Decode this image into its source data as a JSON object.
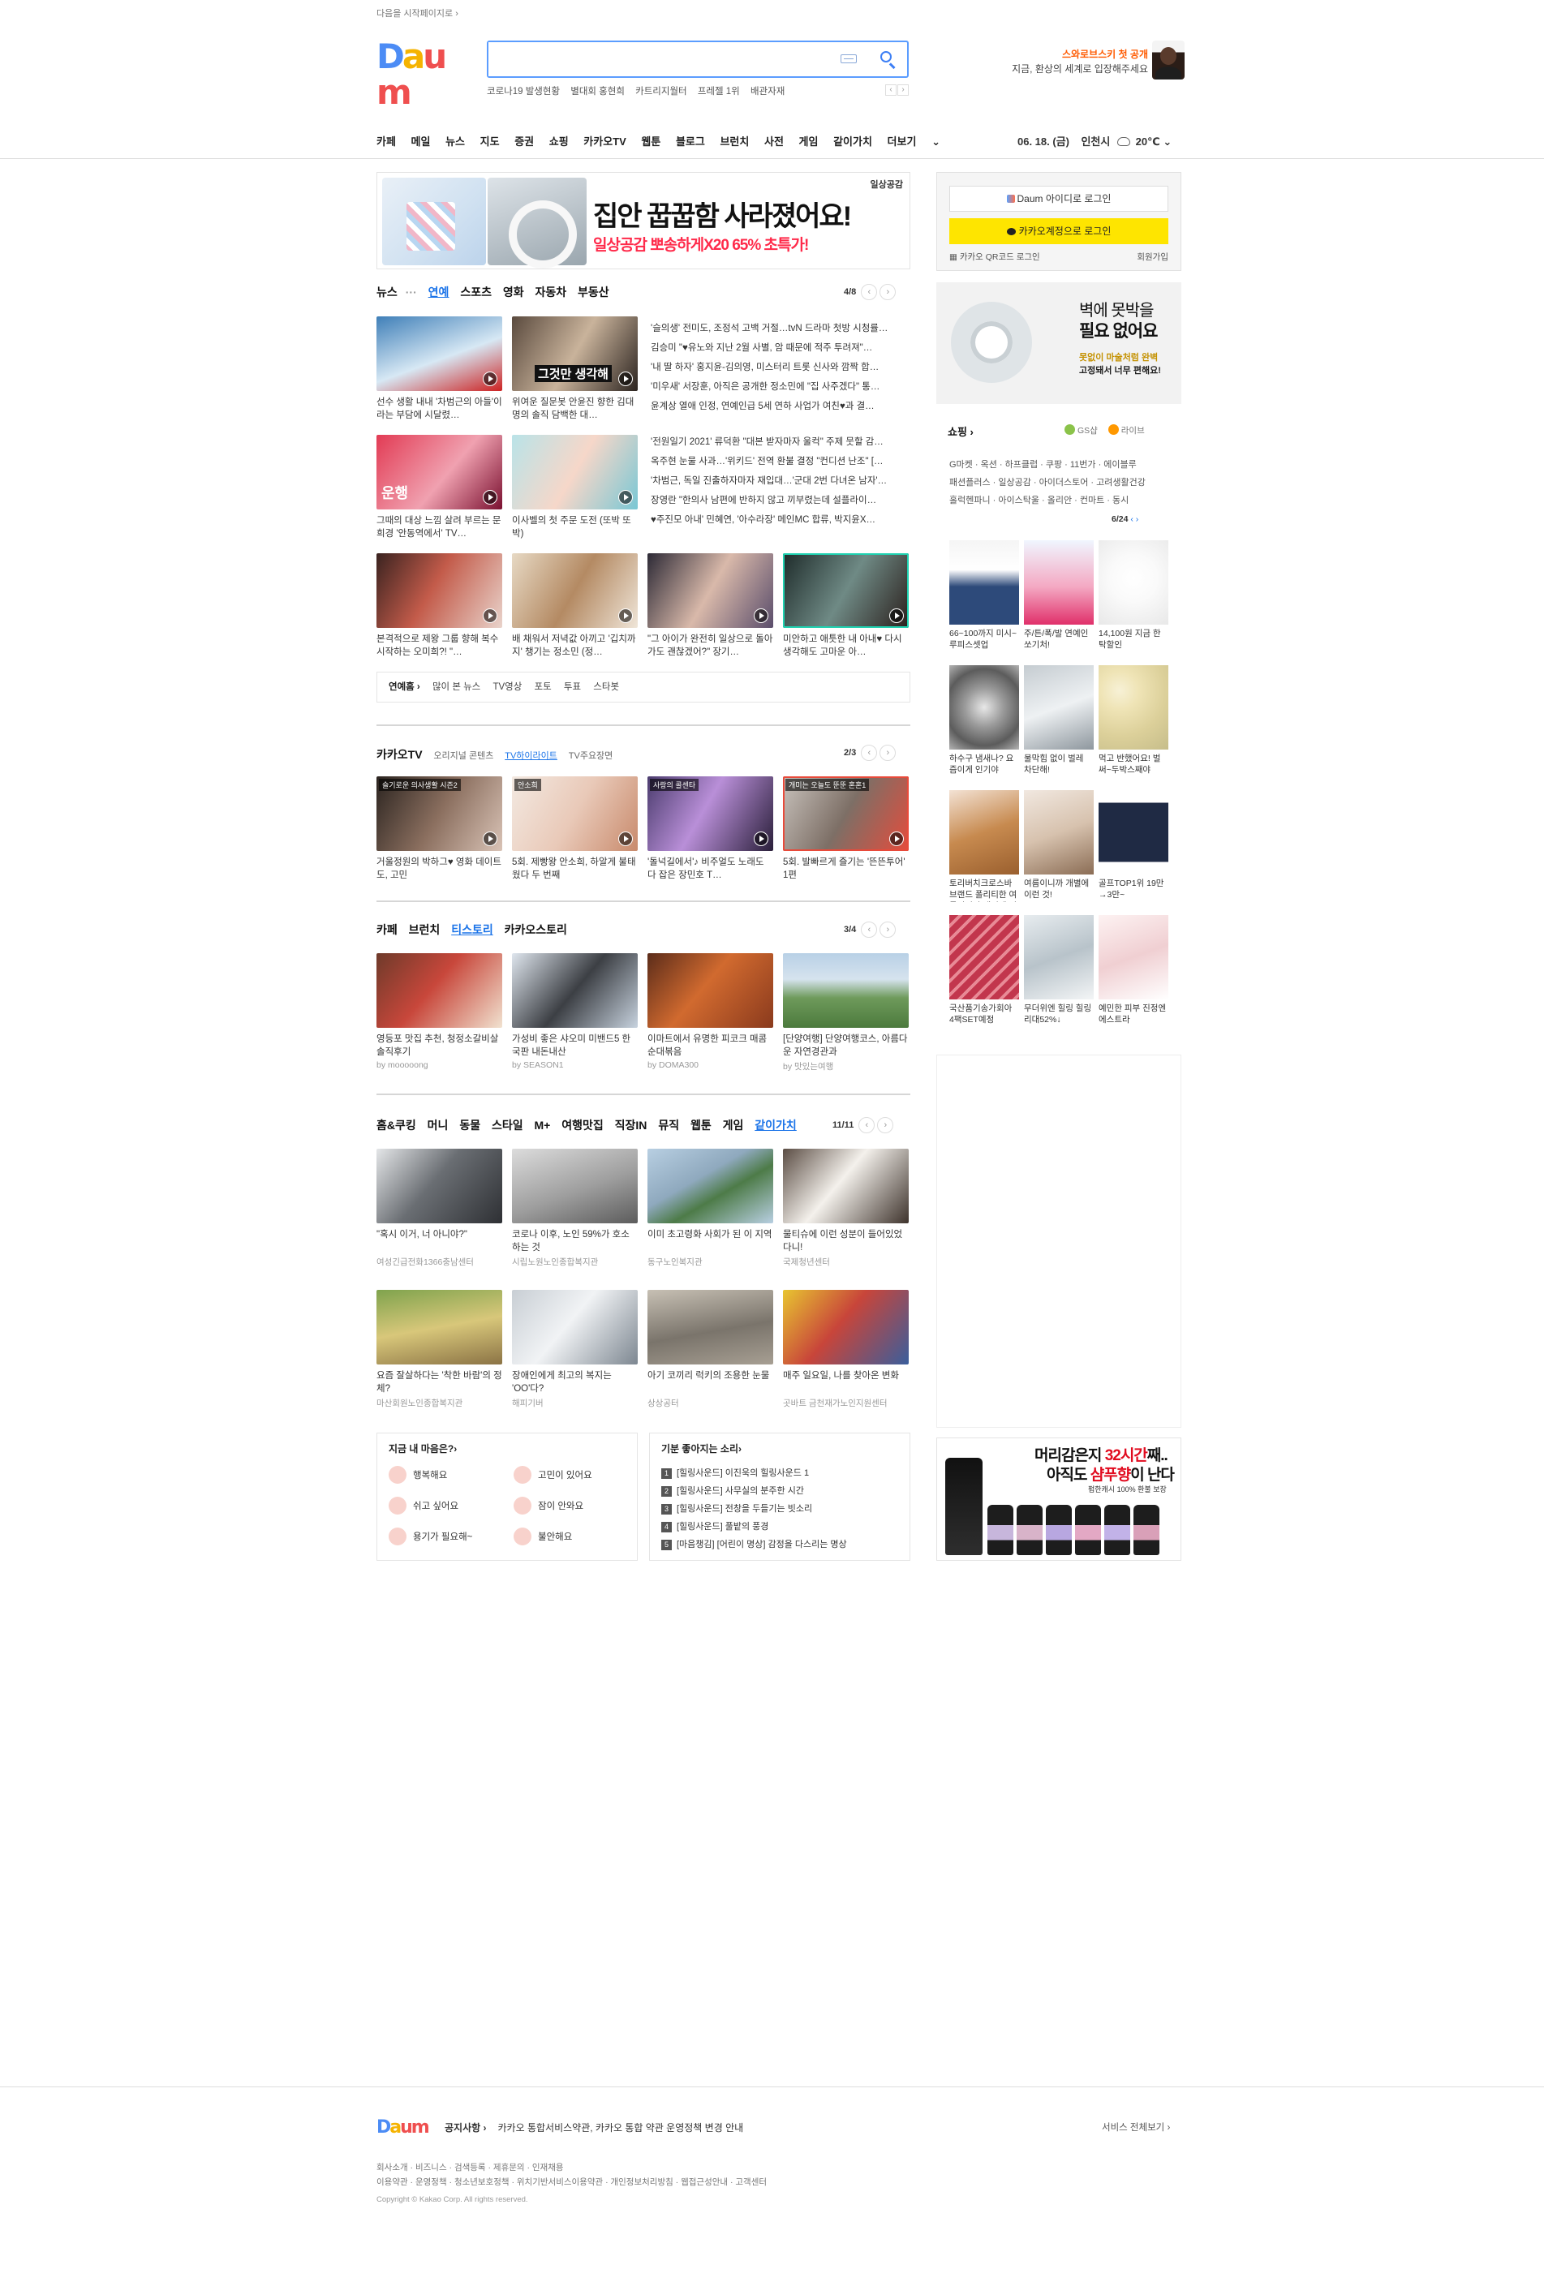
{
  "top": {
    "set_home": "다음을 시작페이지로 ›"
  },
  "logo": {
    "letters": [
      "D",
      "a",
      "u",
      "m"
    ]
  },
  "search": {
    "placeholder": "",
    "value": ""
  },
  "trending": [
    "코로나19 발생현황",
    "별대회 홍현희",
    "카트리지월터",
    "프레젤 1위",
    "배관자재"
  ],
  "promo": {
    "title": "스와로브스키 첫 공개",
    "subtitle": "지금, 환상의 세계로 입장해주세요"
  },
  "gnb": [
    "카페",
    "메일",
    "뉴스",
    "지도",
    "증권",
    "쇼핑",
    "카카오TV",
    "웹툰",
    "블로그",
    "브런치",
    "사전",
    "게임",
    "같이가치",
    "더보기"
  ],
  "weather": {
    "date": "06. 18. (금)",
    "city": "인천시",
    "temp": "20℃"
  },
  "ad_main": {
    "title": "집안 꿉꿉함 사라졌어요!",
    "sub": "일상공감 뽀송하게X20 65% 초특가!",
    "brand": "일상공감"
  },
  "login": {
    "daum_btn": "Daum 아이디로 로그인",
    "kakao_btn": "카카오계정으로 로그인",
    "qr": "카카오 QR코드 로그인",
    "join": "회원가입"
  },
  "ad_tape": {
    "l1": "벽에 못박을",
    "l2": "필요 없어요",
    "l3": "못없이 마술처럼 완벽",
    "l4": "고정돼서 너무 편해요!"
  },
  "news": {
    "tabs": [
      "뉴스",
      "연예",
      "스포츠",
      "영화",
      "자동차",
      "부동산"
    ],
    "active": "연예",
    "page": "4/8",
    "cards": [
      {
        "cap": "선수 생활 내내 '차범근의 아들'이라는 부담에 시달렸…"
      },
      {
        "cap": "위여운 질문봇 안윤진 향한 김대명의 솔직 담백한 대…",
        "overlay": "그것만 생각해"
      },
      {
        "cap": "그때의 대상 느낌 살려 부르는 문희경 '안동역에서' TV…",
        "overlay": "운행"
      },
      {
        "cap": "이사벨의 첫 주문 도전 (또박 또박)"
      },
      {
        "cap": "본격적으로 제왕 그룹 향해 복수 시작하는 오미희?! \"…"
      },
      {
        "cap": "배 채워서 저녁값 아끼고 '깁치까지' 챙기는 정소민 (정…"
      },
      {
        "cap": "\"그 아이가 완전히 일상으로 돌아가도 괜찮겠어?\" 장기…"
      },
      {
        "cap": "미안하고 애틋한 내 아내♥ 다시 생각해도 고마운 아…"
      }
    ],
    "list1": [
      "'슬의생' 전미도, 조정석 고백 거절…tvN 드라마 첫방 시청률…",
      "김승미 \"♥유노와 지난 2월 사별, 암 때문에 적주 투려져\"…",
      "'내 딸 하자' 홍지윤-김의영, 미스터리 트롯 신사와 깜짝 합…",
      "'미우새' 서장훈, 아직은 공개한 정소민에 \"집 사주겠다\" 통…",
      "윤계상 열애 인정, 연예인급 5세 연하 사업가 여친♥과 결…"
    ],
    "list2": [
      "'전원일기 2021' 류덕환 \"대본 받자마자 울컥\" 주제 뭇할 감…",
      "옥주현 눈물 사과…'위키드' 전역 환불 결정 \"컨디션 난조\" […",
      "'차범근, 독일 진출하자마자 재입대…'군대 2번 다녀온 남자'…",
      "장영란 \"한의사 남편에 반하지 않고 끼부렸는데 설플라이…",
      "♥주진모 아내' 민혜연, '아수라장' 메인MC 합류, 박지윤X…"
    ],
    "subtabs": [
      "연예홈 ›",
      "많이 본 뉴스",
      "TV영상",
      "포토",
      "투표",
      "스타봇"
    ]
  },
  "kakaotv": {
    "tabs": [
      "카카오TV",
      "오리지널 콘텐츠",
      "TV하이라이트",
      "TV주요장면"
    ],
    "active": "TV하이라이트",
    "page": "2/3",
    "cards": [
      {
        "tag": "슬기로운 의사생활 시즌2",
        "cap": "거울정원의 박하그♥ 영화 데이트도, 고민"
      },
      {
        "tag": "안소희",
        "cap": "5회. 제빵왕 안소희, 하알게 불태웠다 두 번째"
      },
      {
        "tag": "사랑의 콜센타",
        "cap": "'돌넉길에서'♪ 비주얼도 노래도 다 잡은 장민호 T…"
      },
      {
        "tag": "개미는 오늘도 뚠뚠 혼혼1",
        "cap": "5회. 발빠르게 즐기는 '뜬뜬투어' 1편"
      }
    ]
  },
  "cafe": {
    "tabs": [
      "카페",
      "브런치",
      "티스토리",
      "카카오스토리"
    ],
    "active": "티스토리",
    "page": "3/4",
    "cards": [
      {
        "cap": "영등포 맛집 추천, 청정소갈비살 솔직후기",
        "by": "by mooooong"
      },
      {
        "cap": "가성비 좋은 샤오미 미밴드5 한국판 내돈내산",
        "by": "by SEASON1"
      },
      {
        "cap": "이마트에서 유명한 피코크 매콤 순대볶음",
        "by": "by DOMA300"
      },
      {
        "cap": "[단양여행] 단양여행코스, 아름다운 자연경관과",
        "by": "by 맛있는여행"
      }
    ]
  },
  "life": {
    "tabs": [
      "홈&쿠킹",
      "머니",
      "동물",
      "스타일",
      "M+",
      "여행맛집",
      "직장IN",
      "뮤직",
      "웹툰",
      "게임",
      "같이가치"
    ],
    "active": "같이가치",
    "page": "11/11",
    "cards": [
      {
        "cap": "\"혹시 이거, 너 아니야?\"",
        "by": "여성긴급전화1366충남센터"
      },
      {
        "cap": "코로나 이후, 노인 59%가 호소하는 것",
        "by": "시립노원노인종합복지관"
      },
      {
        "cap": "이미 초고령화 사회가 된 이 지역",
        "by": "동구노인복지관"
      },
      {
        "cap": "물티슈에 이런 성분이 들어있었다니!",
        "by": "국제청년센터"
      },
      {
        "cap": "요즘 잘살하다는 '착한 바람'의 정체?",
        "by": "마산회원노인종합복지관"
      },
      {
        "cap": "장애인에게 최고의 복지는 'OO'다?",
        "by": "해피기버"
      },
      {
        "cap": "아기 코끼리 럭키의 조용한 눈물",
        "by": "상상공터"
      },
      {
        "cap": "매주 일요일, 나를 찾아온 변화",
        "by": "곳바트 금천재가노인지원센터"
      }
    ]
  },
  "mood": {
    "title": "지금 내 마음은?›",
    "items": [
      "행복해요",
      "고민이 있어요",
      "쉬고 싶어요",
      "잠이 안와요",
      "용기가 필요해~",
      "불안해요"
    ]
  },
  "sounds": {
    "title": "기분 좋아지는 소리›",
    "items": [
      "[힐링사운드] 이진욱의 힐링사운드 1",
      "[힐링사운드] 사무실의 분주한 시간",
      "[힐링사운드] 전창을 두들기는 빗소리",
      "[힐링사운드] 풀밭의 풍경",
      "[마음챙김] [어린이 명상] 감정을 다스리는 명상"
    ]
  },
  "shopping": {
    "title": "쇼핑 ›",
    "gs": "GS샵",
    "live": "라이브",
    "cats": [
      "G마켓 · 옥션 · 하프클럽 · 쿠팡 · 11번가 · 에이블루",
      "패션플러스 · 일상공감 · 아이더스토어 · 고려생활건강",
      "홀럭헨파니 · 아이스탁울 · 올리안 · 컨마트 · 동시"
    ],
    "page": "6/24",
    "items": [
      {
        "cap": "66~100까지 미시~루피스셋업"
      },
      {
        "cap": "주/튼/폭/발 연예인 쏘기처!"
      },
      {
        "cap": "14,100원 지금 한탁할인"
      },
      {
        "cap": "하수구 냄새나? 요즘이게 인기야"
      },
      {
        "cap": "물막힘 없이 벌레 차단해!"
      },
      {
        "cap": "먹고 반했어요! 벌써~두박스째야"
      },
      {
        "cap": "토리버치크로스바 브랜드 폴리티한 여름이니까 개별에 이런 것!"
      },
      {
        "cap": "여름이니까 개별에 이런 것!"
      },
      {
        "cap": "골프TOP1위 19만→3만~"
      },
      {
        "cap": "국산품기송가회아 4팩SET예정"
      },
      {
        "cap": "무더위엔 힐링 힐링리대52%↓"
      },
      {
        "cap": "예민한 피부 진정엔 에스트라"
      }
    ]
  },
  "ad_shampoo": {
    "l1a": "머리감은지 ",
    "l1b": "32시간",
    "l1c": "째..",
    "l2a": "아직도 ",
    "l2b": "샴푸향",
    "l2c": "이 난다",
    "l3": "펌한캐시 100% 환불 보장"
  },
  "footer": {
    "notice_label": "공지사항 ›",
    "notice": "카카오 통합서비스약관, 카카오 통합 약관 운영정책 변경 안내",
    "all_services": "서비스 전체보기 ›",
    "links1": "회사소개 · 비즈니스 · 검색등록 · 제휴문의 · 인재채용",
    "links2": "이용약관 · 운영정책 · 청소년보호정책 · 위치기반서비스이용약관 · 개인정보처리방침 · 웹접근성안내 · 고객센터",
    "copyright": "Copyright © Kakao Corp. All rights reserved."
  }
}
